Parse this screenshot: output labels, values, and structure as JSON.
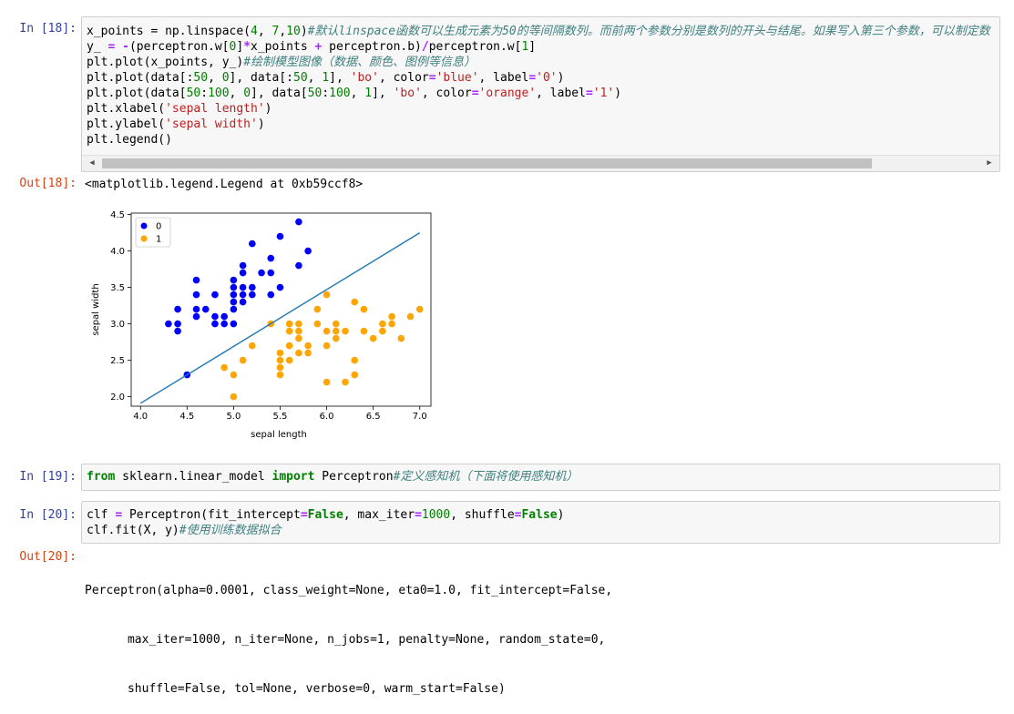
{
  "cells": [
    {
      "in_prompt": "In  [18]:",
      "code_lines": [
        [
          {
            "t": "x_points = np.linspace("
          },
          {
            "t": "4",
            "c": "num"
          },
          {
            "t": ", "
          },
          {
            "t": "7",
            "c": "num"
          },
          {
            "t": ","
          },
          {
            "t": "10",
            "c": "num"
          },
          {
            "t": ")"
          },
          {
            "t": "#默认linspace函数可以生成元素为50的等间隔数列。而前两个参数分别是数列的开头与结尾。如果写入第三个参数，可以制定数",
            "c": "cmt"
          }
        ],
        [
          {
            "t": "y_ "
          },
          {
            "t": "=",
            "c": "op"
          },
          {
            "t": " "
          },
          {
            "t": "-",
            "c": "op"
          },
          {
            "t": "(perceptron.w["
          },
          {
            "t": "0",
            "c": "num"
          },
          {
            "t": "]"
          },
          {
            "t": "*",
            "c": "op"
          },
          {
            "t": "x_points "
          },
          {
            "t": "+",
            "c": "op"
          },
          {
            "t": " perceptron.b)"
          },
          {
            "t": "/",
            "c": "op"
          },
          {
            "t": "perceptron.w["
          },
          {
            "t": "1",
            "c": "num"
          },
          {
            "t": "]"
          }
        ],
        [
          {
            "t": "plt.plot(x_points, y_)"
          },
          {
            "t": "#绘制模型图像（数据、颜色、图例等信息）",
            "c": "cmt"
          }
        ],
        [
          {
            "t": "plt.plot(data[:"
          },
          {
            "t": "50",
            "c": "num"
          },
          {
            "t": ", "
          },
          {
            "t": "0",
            "c": "num"
          },
          {
            "t": "], data[:"
          },
          {
            "t": "50",
            "c": "num"
          },
          {
            "t": ", "
          },
          {
            "t": "1",
            "c": "num"
          },
          {
            "t": "], "
          },
          {
            "t": "'bo'",
            "c": "str"
          },
          {
            "t": ", color"
          },
          {
            "t": "=",
            "c": "op"
          },
          {
            "t": "'blue'",
            "c": "str"
          },
          {
            "t": ", label"
          },
          {
            "t": "=",
            "c": "op"
          },
          {
            "t": "'0'",
            "c": "str"
          },
          {
            "t": ")"
          }
        ],
        [
          {
            "t": "plt.plot(data["
          },
          {
            "t": "50",
            "c": "num"
          },
          {
            "t": ":"
          },
          {
            "t": "100",
            "c": "num"
          },
          {
            "t": ", "
          },
          {
            "t": "0",
            "c": "num"
          },
          {
            "t": "], data["
          },
          {
            "t": "50",
            "c": "num"
          },
          {
            "t": ":"
          },
          {
            "t": "100",
            "c": "num"
          },
          {
            "t": ", "
          },
          {
            "t": "1",
            "c": "num"
          },
          {
            "t": "], "
          },
          {
            "t": "'bo'",
            "c": "str"
          },
          {
            "t": ", color"
          },
          {
            "t": "=",
            "c": "op"
          },
          {
            "t": "'orange'",
            "c": "str"
          },
          {
            "t": ", label"
          },
          {
            "t": "=",
            "c": "op"
          },
          {
            "t": "'1'",
            "c": "str"
          },
          {
            "t": ")"
          }
        ],
        [
          {
            "t": "plt.xlabel("
          },
          {
            "t": "'sepal length'",
            "c": "str"
          },
          {
            "t": ")"
          }
        ],
        [
          {
            "t": "plt.ylabel("
          },
          {
            "t": "'sepal width'",
            "c": "str"
          },
          {
            "t": ")"
          }
        ],
        [
          {
            "t": "plt.legend()"
          }
        ]
      ],
      "out_prompt": "Out[18]:",
      "output_text": "<matplotlib.legend.Legend at 0xb59ccf8>"
    },
    {
      "in_prompt": "In  [19]:",
      "code_lines": [
        [
          {
            "t": "from",
            "c": "kw"
          },
          {
            "t": " sklearn.linear_model "
          },
          {
            "t": "import",
            "c": "kw"
          },
          {
            "t": " Perceptron"
          },
          {
            "t": "#定义感知机（下面将使用感知机）",
            "c": "cmt"
          }
        ]
      ]
    },
    {
      "in_prompt": "In  [20]:",
      "code_lines": [
        [
          {
            "t": "clf "
          },
          {
            "t": "=",
            "c": "op"
          },
          {
            "t": " Perceptron(fit_intercept"
          },
          {
            "t": "=",
            "c": "op"
          },
          {
            "t": "False",
            "c": "kw"
          },
          {
            "t": ", max_iter"
          },
          {
            "t": "=",
            "c": "op"
          },
          {
            "t": "1000",
            "c": "num"
          },
          {
            "t": ", shuffle"
          },
          {
            "t": "=",
            "c": "op"
          },
          {
            "t": "False",
            "c": "kw"
          },
          {
            "t": ")"
          }
        ],
        [
          {
            "t": "clf.fit(X, y)"
          },
          {
            "t": "#使用训练数据拟合",
            "c": "cmt"
          }
        ]
      ],
      "out_prompt": "Out[20]:",
      "output_lines": [
        "Perceptron(alpha=0.0001, class_weight=None, eta0=1.0, fit_intercept=False,",
        "      max_iter=1000, n_iter=None, n_jobs=1, penalty=None, random_state=0,",
        "      shuffle=False, tol=None, verbose=0, warm_start=False)"
      ]
    }
  ],
  "scrollbar": {
    "left_arrow": "◀",
    "right_arrow": "▶"
  },
  "chart_data": {
    "type": "scatter",
    "xlabel": "sepal length",
    "ylabel": "sepal width",
    "xlim": [
      3.9,
      7.12
    ],
    "ylim": [
      1.87,
      4.52
    ],
    "xticks": [
      "4.0",
      "4.5",
      "5.0",
      "5.5",
      "6.0",
      "6.5",
      "7.0"
    ],
    "yticks": [
      "2.0",
      "2.5",
      "3.0",
      "3.5",
      "4.0",
      "4.5"
    ],
    "legend_position": "top-left",
    "series": [
      {
        "name": "0",
        "color": "#0000ff",
        "points": [
          [
            4.3,
            3.0
          ],
          [
            4.4,
            2.9
          ],
          [
            4.4,
            3.0
          ],
          [
            4.4,
            3.2
          ],
          [
            4.5,
            2.3
          ],
          [
            4.6,
            3.1
          ],
          [
            4.6,
            3.2
          ],
          [
            4.6,
            3.4
          ],
          [
            4.6,
            3.6
          ],
          [
            4.7,
            3.2
          ],
          [
            4.8,
            3.0
          ],
          [
            4.8,
            3.1
          ],
          [
            4.8,
            3.4
          ],
          [
            4.9,
            3.0
          ],
          [
            4.9,
            3.1
          ],
          [
            5.0,
            3.0
          ],
          [
            5.0,
            3.2
          ],
          [
            5.0,
            3.3
          ],
          [
            5.0,
            3.4
          ],
          [
            5.0,
            3.5
          ],
          [
            5.0,
            3.6
          ],
          [
            5.1,
            3.3
          ],
          [
            5.1,
            3.4
          ],
          [
            5.1,
            3.5
          ],
          [
            5.1,
            3.7
          ],
          [
            5.1,
            3.8
          ],
          [
            5.2,
            3.4
          ],
          [
            5.2,
            3.5
          ],
          [
            5.2,
            4.1
          ],
          [
            5.3,
            3.7
          ],
          [
            5.4,
            3.4
          ],
          [
            5.4,
            3.7
          ],
          [
            5.4,
            3.9
          ],
          [
            5.5,
            3.5
          ],
          [
            5.5,
            4.2
          ],
          [
            5.7,
            3.8
          ],
          [
            5.7,
            4.4
          ],
          [
            5.8,
            4.0
          ]
        ]
      },
      {
        "name": "1",
        "color": "#ffa500",
        "points": [
          [
            4.9,
            2.4
          ],
          [
            5.0,
            2.0
          ],
          [
            5.0,
            2.3
          ],
          [
            5.1,
            2.5
          ],
          [
            5.2,
            2.7
          ],
          [
            5.4,
            3.0
          ],
          [
            5.5,
            2.3
          ],
          [
            5.5,
            2.4
          ],
          [
            5.5,
            2.5
          ],
          [
            5.5,
            2.6
          ],
          [
            5.6,
            2.5
          ],
          [
            5.6,
            2.7
          ],
          [
            5.6,
            2.9
          ],
          [
            5.6,
            3.0
          ],
          [
            5.7,
            2.6
          ],
          [
            5.7,
            2.8
          ],
          [
            5.7,
            2.9
          ],
          [
            5.7,
            3.0
          ],
          [
            5.8,
            2.6
          ],
          [
            5.8,
            2.7
          ],
          [
            5.9,
            3.0
          ],
          [
            5.9,
            3.2
          ],
          [
            6.0,
            2.2
          ],
          [
            6.0,
            2.7
          ],
          [
            6.0,
            2.9
          ],
          [
            6.0,
            3.4
          ],
          [
            6.1,
            2.8
          ],
          [
            6.1,
            2.9
          ],
          [
            6.1,
            3.0
          ],
          [
            6.2,
            2.2
          ],
          [
            6.2,
            2.9
          ],
          [
            6.3,
            2.3
          ],
          [
            6.3,
            2.5
          ],
          [
            6.3,
            3.3
          ],
          [
            6.4,
            2.9
          ],
          [
            6.4,
            3.2
          ],
          [
            6.5,
            2.8
          ],
          [
            6.6,
            2.9
          ],
          [
            6.6,
            3.0
          ],
          [
            6.7,
            3.0
          ],
          [
            6.7,
            3.1
          ],
          [
            6.8,
            2.8
          ],
          [
            6.9,
            3.1
          ],
          [
            7.0,
            3.2
          ]
        ]
      }
    ],
    "line": {
      "color": "#1f77b4",
      "x": [
        4.0,
        7.0
      ],
      "y": [
        1.91,
        4.25
      ]
    }
  }
}
